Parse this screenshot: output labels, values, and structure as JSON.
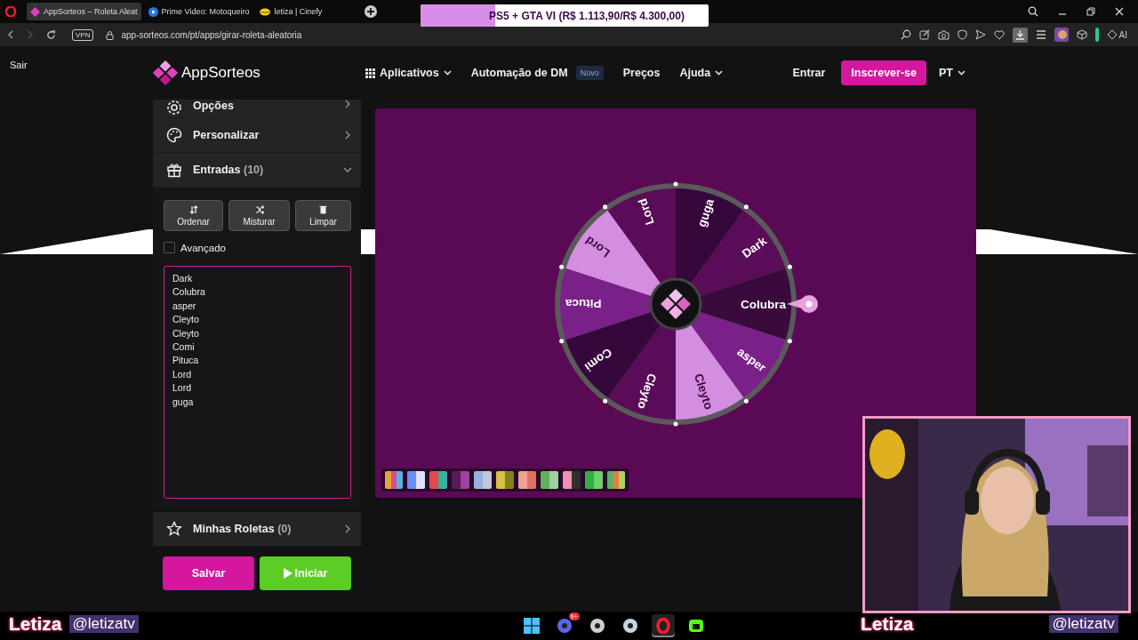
{
  "browser": {
    "tabs": [
      {
        "title": "AppSorteos – Roleta Aleat",
        "kind": "diamond",
        "selected": true
      },
      {
        "title": "Prime Video: Motoqueiro",
        "kind": "play",
        "selected": false
      },
      {
        "title": "letiza | Cinefy",
        "kind": "lips",
        "selected": false
      }
    ],
    "vpn_badge": "VPN",
    "address": "app-sorteos.com/pt/apps/girar-roleta-aleatoria",
    "ai_button": "AI"
  },
  "goal_banner": {
    "text": "PS5 + GTA VI (R$ 1.113,90/R$ 4.300,00)",
    "level": 0.26
  },
  "overlay_label": "Sair",
  "nav": {
    "brand": "AppSorteos",
    "items": [
      {
        "label": "Aplicativos",
        "kind": "apps"
      },
      {
        "label": "Automação de DM",
        "kind": "badge",
        "badge": "Novo"
      },
      {
        "label": "Preços",
        "kind": "link"
      },
      {
        "label": "Ajuda",
        "kind": "dropdown"
      }
    ],
    "login": "Entrar",
    "signup": "Inscrever-se",
    "language": "PT"
  },
  "sidebar": {
    "sections": [
      {
        "title": "Opções",
        "kind": "gear",
        "expanded": false
      },
      {
        "title": "Personalizar",
        "kind": "palette",
        "expanded": false
      },
      {
        "title": "Entradas",
        "count": "(10)",
        "kind": "gift",
        "expanded": true
      }
    ],
    "actions": [
      {
        "label": "Ordenar",
        "kind": "sort"
      },
      {
        "label": "Misturar",
        "kind": "shuffle"
      },
      {
        "label": "Limpar",
        "kind": "trash"
      }
    ],
    "advanced": {
      "label": "Avançado",
      "checked": false
    },
    "entries": [
      "Dark",
      "Colubra",
      "asper",
      "Cleyto",
      "Cleyto",
      "Comi",
      "Pituca",
      "Lord",
      "Lord",
      "guga"
    ],
    "saved": {
      "title": "Minhas Roletas",
      "count": "(0)",
      "expanded": false
    },
    "save_button": "Salvar",
    "start_button": "Iniciar"
  },
  "wheel": {
    "segments": [
      {
        "label": "Colubra",
        "color": "#3a0a3c"
      },
      {
        "label": "asper",
        "color": "#7a2089"
      },
      {
        "label": "Cleyto",
        "color": "#d48ee0"
      },
      {
        "label": "Cleyto",
        "color": "#5a0c58"
      },
      {
        "label": "Comi",
        "color": "#36073a"
      },
      {
        "label": "Pituca",
        "color": "#7a2089"
      },
      {
        "label": "Lord",
        "color": "#d48ee0"
      },
      {
        "label": "Lord",
        "color": "#5a0c58"
      },
      {
        "label": "guga",
        "color": "#36073a"
      },
      {
        "label": "Dark",
        "color": "#5a0c58"
      }
    ]
  },
  "stream_tags": [
    {
      "name": "Letiza",
      "handle": "@letizatv"
    },
    {
      "name": "Letiza",
      "handle": "@letizatv"
    }
  ],
  "taskbar": {
    "apps": [
      {
        "kind": "windows",
        "active": false
      },
      {
        "kind": "chat",
        "active": false,
        "badge": "9+"
      },
      {
        "kind": "record",
        "active": false
      },
      {
        "kind": "steam",
        "active": false
      },
      {
        "kind": "browser",
        "active": true
      },
      {
        "kind": "tv",
        "active": false
      }
    ]
  }
}
